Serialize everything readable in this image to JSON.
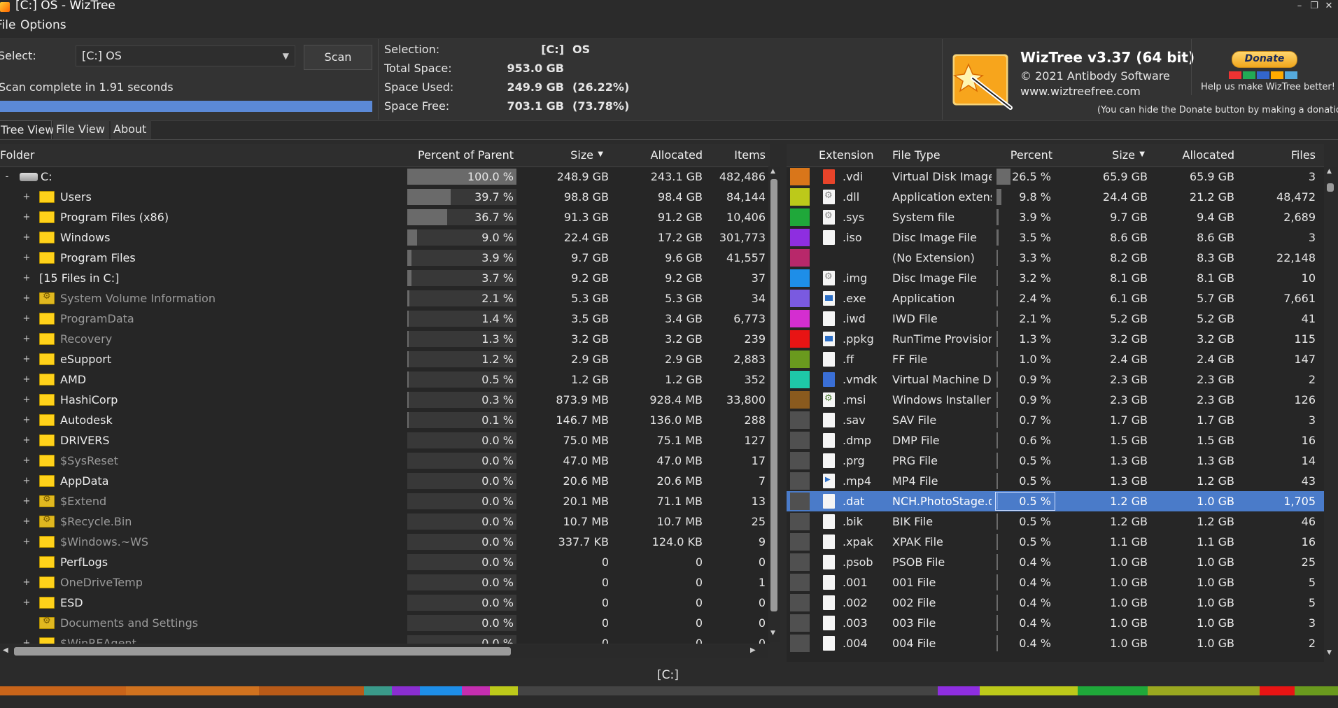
{
  "window": {
    "title": "[C:] OS  - WizTree"
  },
  "menu": [
    {
      "label": "File"
    },
    {
      "label": "Options"
    }
  ],
  "scan": {
    "select_label": "Select:",
    "drive_value": "[C:] OS",
    "scan_button": "Scan",
    "status": "Scan complete in 1.91 seconds",
    "progress_percent": 100
  },
  "summary": {
    "selection_label": "Selection:",
    "selection_drive": "[C:]",
    "selection_name": "OS",
    "total_label": "Total Space:",
    "total_value": "953.0 GB",
    "used_label": "Space Used:",
    "used_value": "249.9 GB",
    "used_pct": "(26.22%)",
    "free_label": "Space Free:",
    "free_value": "703.1 GB",
    "free_pct": "(73.78%)"
  },
  "about": {
    "title": "WizTree v3.37 (64 bit)",
    "copyright": "© 2021 Antibody Software",
    "url": "www.wiztreefree.com",
    "donate_button": "Donate",
    "donate_message": "Help us make WizTree better!",
    "donate_note": "(You can hide the Donate button by making a donation)"
  },
  "tabs": [
    {
      "label": "Tree View"
    },
    {
      "label": "File View"
    },
    {
      "label": "About"
    }
  ],
  "tree": {
    "columns": {
      "folder": "Folder",
      "percent": "Percent of Parent",
      "size": "Size",
      "allocated": "Allocated",
      "items": "Items"
    },
    "rows": [
      {
        "name": "C:",
        "pct": "100.0 %",
        "pct_value": 100.0,
        "size": "248.9 GB",
        "alloc": "243.1 GB",
        "items": "482,486",
        "icon": "drive-icon",
        "level": 0,
        "expander": "-",
        "dim": false
      },
      {
        "name": "Users",
        "pct": "39.7 %",
        "pct_value": 39.7,
        "size": "98.8 GB",
        "alloc": "98.4 GB",
        "items": "84,144",
        "icon": "folder-icon",
        "level": 1,
        "expander": "+",
        "dim": false
      },
      {
        "name": "Program Files (x86)",
        "pct": "36.7 %",
        "pct_value": 36.7,
        "size": "91.3 GB",
        "alloc": "91.2 GB",
        "items": "10,406",
        "icon": "folder-icon",
        "level": 1,
        "expander": "+",
        "dim": false
      },
      {
        "name": "Windows",
        "pct": "9.0 %",
        "pct_value": 9.0,
        "size": "22.4 GB",
        "alloc": "17.2 GB",
        "items": "301,773",
        "icon": "folder-icon",
        "level": 1,
        "expander": "+",
        "dim": false
      },
      {
        "name": "Program Files",
        "pct": "3.9 %",
        "pct_value": 3.9,
        "size": "9.7 GB",
        "alloc": "9.6 GB",
        "items": "41,557",
        "icon": "folder-icon",
        "level": 1,
        "expander": "+",
        "dim": false
      },
      {
        "name": "[15 Files in C:]",
        "pct": "3.7 %",
        "pct_value": 3.7,
        "size": "9.2 GB",
        "alloc": "9.2 GB",
        "items": "37",
        "icon": "",
        "level": 1,
        "expander": "+",
        "dim": false
      },
      {
        "name": "System Volume Information",
        "pct": "2.1 %",
        "pct_value": 2.1,
        "size": "5.3 GB",
        "alloc": "5.3 GB",
        "items": "34",
        "icon": "folder-icon-system",
        "level": 1,
        "expander": "+",
        "dim": true
      },
      {
        "name": "ProgramData",
        "pct": "1.4 %",
        "pct_value": 1.4,
        "size": "3.5 GB",
        "alloc": "3.4 GB",
        "items": "6,773",
        "icon": "folder-icon",
        "level": 1,
        "expander": "+",
        "dim": true
      },
      {
        "name": "Recovery",
        "pct": "1.3 %",
        "pct_value": 1.3,
        "size": "3.2 GB",
        "alloc": "3.2 GB",
        "items": "239",
        "icon": "folder-icon",
        "level": 1,
        "expander": "+",
        "dim": true
      },
      {
        "name": "eSupport",
        "pct": "1.2 %",
        "pct_value": 1.2,
        "size": "2.9 GB",
        "alloc": "2.9 GB",
        "items": "2,883",
        "icon": "folder-icon",
        "level": 1,
        "expander": "+",
        "dim": false
      },
      {
        "name": "AMD",
        "pct": "0.5 %",
        "pct_value": 0.5,
        "size": "1.2 GB",
        "alloc": "1.2 GB",
        "items": "352",
        "icon": "folder-icon",
        "level": 1,
        "expander": "+",
        "dim": false
      },
      {
        "name": "HashiCorp",
        "pct": "0.3 %",
        "pct_value": 0.3,
        "size": "873.9 MB",
        "alloc": "928.4 MB",
        "items": "33,800",
        "icon": "folder-icon",
        "level": 1,
        "expander": "+",
        "dim": false
      },
      {
        "name": "Autodesk",
        "pct": "0.1 %",
        "pct_value": 0.1,
        "size": "146.7 MB",
        "alloc": "136.0 MB",
        "items": "288",
        "icon": "folder-icon",
        "level": 1,
        "expander": "+",
        "dim": false
      },
      {
        "name": "DRIVERS",
        "pct": "0.0 %",
        "pct_value": 0.0,
        "size": "75.0 MB",
        "alloc": "75.1 MB",
        "items": "127",
        "icon": "folder-icon",
        "level": 1,
        "expander": "+",
        "dim": false
      },
      {
        "name": "$SysReset",
        "pct": "0.0 %",
        "pct_value": 0.0,
        "size": "47.0 MB",
        "alloc": "47.0 MB",
        "items": "17",
        "icon": "folder-icon",
        "level": 1,
        "expander": "+",
        "dim": true
      },
      {
        "name": "AppData",
        "pct": "0.0 %",
        "pct_value": 0.0,
        "size": "20.6 MB",
        "alloc": "20.6 MB",
        "items": "7",
        "icon": "folder-icon",
        "level": 1,
        "expander": "+",
        "dim": false
      },
      {
        "name": "$Extend",
        "pct": "0.0 %",
        "pct_value": 0.0,
        "size": "20.1 MB",
        "alloc": "71.1 MB",
        "items": "13",
        "icon": "folder-icon-system",
        "level": 1,
        "expander": "+",
        "dim": true
      },
      {
        "name": "$Recycle.Bin",
        "pct": "0.0 %",
        "pct_value": 0.0,
        "size": "10.7 MB",
        "alloc": "10.7 MB",
        "items": "25",
        "icon": "folder-icon-system",
        "level": 1,
        "expander": "+",
        "dim": true
      },
      {
        "name": "$Windows.~WS",
        "pct": "0.0 %",
        "pct_value": 0.0,
        "size": "337.7 KB",
        "alloc": "124.0 KB",
        "items": "9",
        "icon": "folder-icon",
        "level": 1,
        "expander": "+",
        "dim": true
      },
      {
        "name": "PerfLogs",
        "pct": "0.0 %",
        "pct_value": 0.0,
        "size": "0",
        "alloc": "0",
        "items": "0",
        "icon": "folder-icon",
        "level": 1,
        "expander": "",
        "dim": false
      },
      {
        "name": "OneDriveTemp",
        "pct": "0.0 %",
        "pct_value": 0.0,
        "size": "0",
        "alloc": "0",
        "items": "1",
        "icon": "folder-icon",
        "level": 1,
        "expander": "+",
        "dim": true
      },
      {
        "name": "ESD",
        "pct": "0.0 %",
        "pct_value": 0.0,
        "size": "0",
        "alloc": "0",
        "items": "0",
        "icon": "folder-icon",
        "level": 1,
        "expander": "+",
        "dim": false
      },
      {
        "name": "Documents and Settings",
        "pct": "0.0 %",
        "pct_value": 0.0,
        "size": "0",
        "alloc": "0",
        "items": "0",
        "icon": "folder-icon-system",
        "level": 1,
        "expander": "",
        "dim": true
      },
      {
        "name": "$WinREAgent",
        "pct": "0.0 %",
        "pct_value": 0.0,
        "size": "0",
        "alloc": "0",
        "items": "0",
        "icon": "folder-icon",
        "level": 1,
        "expander": "+",
        "dim": true
      }
    ]
  },
  "files": {
    "columns": {
      "extension": "Extension",
      "type": "File Type",
      "percent": "Percent",
      "size": "Size",
      "allocated": "Allocated",
      "files": "Files"
    },
    "rows": [
      {
        "ext": ".vdi",
        "type": "Virtual Disk Image",
        "pct": "26.5 %",
        "pct_value": 26.5,
        "size": "65.9 GB",
        "alloc": "65.9 GB",
        "files": "3",
        "color": "#d9761a",
        "icon": "vdi-icon"
      },
      {
        "ext": ".dll",
        "type": "Application extension",
        "pct": "9.8 %",
        "pct_value": 9.8,
        "size": "24.4 GB",
        "alloc": "21.2 GB",
        "files": "48,472",
        "color": "#bcc91a",
        "icon": "gear-file-icon"
      },
      {
        "ext": ".sys",
        "type": "System file",
        "pct": "3.9 %",
        "pct_value": 3.9,
        "size": "9.7 GB",
        "alloc": "9.4 GB",
        "files": "2,689",
        "color": "#1fa83a",
        "icon": "gear-file-icon"
      },
      {
        "ext": ".iso",
        "type": "Disc Image File",
        "pct": "3.5 %",
        "pct_value": 3.5,
        "size": "8.6 GB",
        "alloc": "8.6 GB",
        "files": "3",
        "color": "#8e2ee0",
        "icon": "file-icon"
      },
      {
        "ext": "",
        "type": "(No Extension)",
        "pct": "3.3 %",
        "pct_value": 3.3,
        "size": "8.2 GB",
        "alloc": "8.3 GB",
        "files": "22,148",
        "color": "#b8286a",
        "icon": ""
      },
      {
        "ext": ".img",
        "type": "Disc Image File",
        "pct": "3.2 %",
        "pct_value": 3.2,
        "size": "8.1 GB",
        "alloc": "8.1 GB",
        "files": "10",
        "color": "#1e8ee8",
        "icon": "gear-file-icon"
      },
      {
        "ext": ".exe",
        "type": "Application",
        "pct": "2.4 %",
        "pct_value": 2.4,
        "size": "6.1 GB",
        "alloc": "5.7 GB",
        "files": "7,661",
        "color": "#7a5ae0",
        "icon": "exe-file-icon"
      },
      {
        "ext": ".iwd",
        "type": "IWD File",
        "pct": "2.1 %",
        "pct_value": 2.1,
        "size": "5.2 GB",
        "alloc": "5.2 GB",
        "files": "41",
        "color": "#d42ed0",
        "icon": "file-icon"
      },
      {
        "ext": ".ppkg",
        "type": "RunTime Provisioning",
        "pct": "1.3 %",
        "pct_value": 1.3,
        "size": "3.2 GB",
        "alloc": "3.2 GB",
        "files": "115",
        "color": "#e81414",
        "icon": "exe-file-icon"
      },
      {
        "ext": ".ff",
        "type": "FF File",
        "pct": "1.0 %",
        "pct_value": 1.0,
        "size": "2.4 GB",
        "alloc": "2.4 GB",
        "files": "147",
        "color": "#6a9a1e",
        "icon": "file-icon"
      },
      {
        "ext": ".vmdk",
        "type": "Virtual Machine Disk",
        "pct": "0.9 %",
        "pct_value": 0.9,
        "size": "2.3 GB",
        "alloc": "2.3 GB",
        "files": "2",
        "color": "#1ec8a8",
        "icon": "vmdk-icon"
      },
      {
        "ext": ".msi",
        "type": "Windows Installer",
        "pct": "0.9 %",
        "pct_value": 0.9,
        "size": "2.3 GB",
        "alloc": "2.3 GB",
        "files": "126",
        "color": "#8a5a1e",
        "icon": "msi-icon"
      },
      {
        "ext": ".sav",
        "type": "SAV File",
        "pct": "0.7 %",
        "pct_value": 0.7,
        "size": "1.7 GB",
        "alloc": "1.7 GB",
        "files": "3",
        "color": "#505050",
        "icon": "file-icon"
      },
      {
        "ext": ".dmp",
        "type": "DMP File",
        "pct": "0.6 %",
        "pct_value": 0.6,
        "size": "1.5 GB",
        "alloc": "1.5 GB",
        "files": "16",
        "color": "#505050",
        "icon": "file-icon"
      },
      {
        "ext": ".prg",
        "type": "PRG File",
        "pct": "0.5 %",
        "pct_value": 0.5,
        "size": "1.3 GB",
        "alloc": "1.3 GB",
        "files": "14",
        "color": "#505050",
        "icon": "file-icon"
      },
      {
        "ext": ".mp4",
        "type": "MP4 File",
        "pct": "0.5 %",
        "pct_value": 0.5,
        "size": "1.3 GB",
        "alloc": "1.2 GB",
        "files": "43",
        "color": "#505050",
        "icon": "mp4-file-icon"
      },
      {
        "ext": ".dat",
        "type": "NCH.PhotoStage.dat",
        "pct": "0.5 %",
        "pct_value": 0.5,
        "size": "1.2 GB",
        "alloc": "1.0 GB",
        "files": "1,705",
        "color": "#505050",
        "icon": "file-icon",
        "selected": true
      },
      {
        "ext": ".bik",
        "type": "BIK File",
        "pct": "0.5 %",
        "pct_value": 0.5,
        "size": "1.2 GB",
        "alloc": "1.2 GB",
        "files": "46",
        "color": "#505050",
        "icon": "file-icon"
      },
      {
        "ext": ".xpak",
        "type": "XPAK File",
        "pct": "0.5 %",
        "pct_value": 0.5,
        "size": "1.1 GB",
        "alloc": "1.1 GB",
        "files": "16",
        "color": "#505050",
        "icon": "file-icon"
      },
      {
        "ext": ".psob",
        "type": "PSOB File",
        "pct": "0.4 %",
        "pct_value": 0.4,
        "size": "1.0 GB",
        "alloc": "1.0 GB",
        "files": "25",
        "color": "#505050",
        "icon": "file-icon"
      },
      {
        "ext": ".001",
        "type": "001 File",
        "pct": "0.4 %",
        "pct_value": 0.4,
        "size": "1.0 GB",
        "alloc": "1.0 GB",
        "files": "5",
        "color": "#505050",
        "icon": "file-icon"
      },
      {
        "ext": ".002",
        "type": "002 File",
        "pct": "0.4 %",
        "pct_value": 0.4,
        "size": "1.0 GB",
        "alloc": "1.0 GB",
        "files": "5",
        "color": "#505050",
        "icon": "file-icon"
      },
      {
        "ext": ".003",
        "type": "003 File",
        "pct": "0.4 %",
        "pct_value": 0.4,
        "size": "1.0 GB",
        "alloc": "1.0 GB",
        "files": "3",
        "color": "#505050",
        "icon": "file-icon"
      },
      {
        "ext": ".004",
        "type": "004 File",
        "pct": "0.4 %",
        "pct_value": 0.4,
        "size": "1.0 GB",
        "alloc": "1.0 GB",
        "files": "2",
        "color": "#505050",
        "icon": "file-icon"
      }
    ]
  },
  "statusbar": {
    "drive": "[C:]"
  },
  "colors": {
    "accent": "#5b89d6",
    "selection": "#4a7bc9",
    "background": "#2b2b2b"
  }
}
